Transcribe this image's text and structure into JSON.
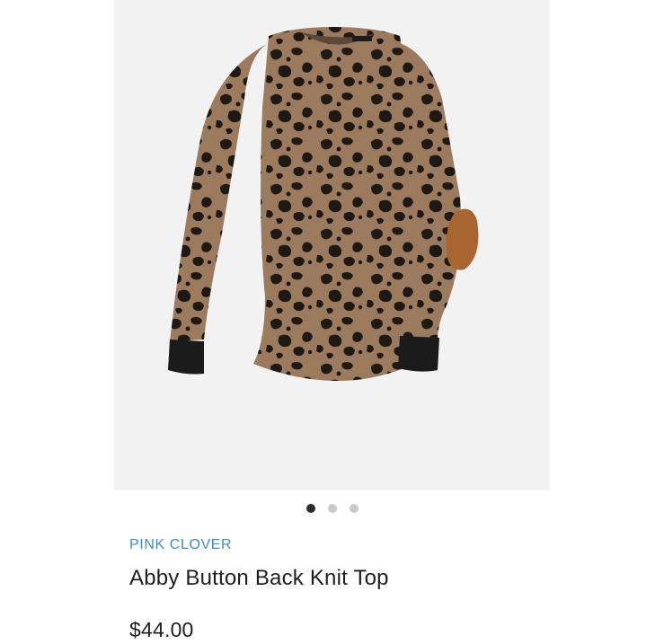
{
  "product": {
    "image_description_icon": "leopard-print-top-image",
    "brand": "PINK CLOVER",
    "title": "Abby Button Back Knit Top",
    "price": "$44.00"
  },
  "carousel": {
    "total": 3,
    "active_index": 1
  },
  "colors": {
    "brand_link": "#3c8dc4",
    "image_background": "#f2f2f2",
    "dot_active": "#2c2c2c",
    "dot_inactive": "#c9c9c9"
  }
}
